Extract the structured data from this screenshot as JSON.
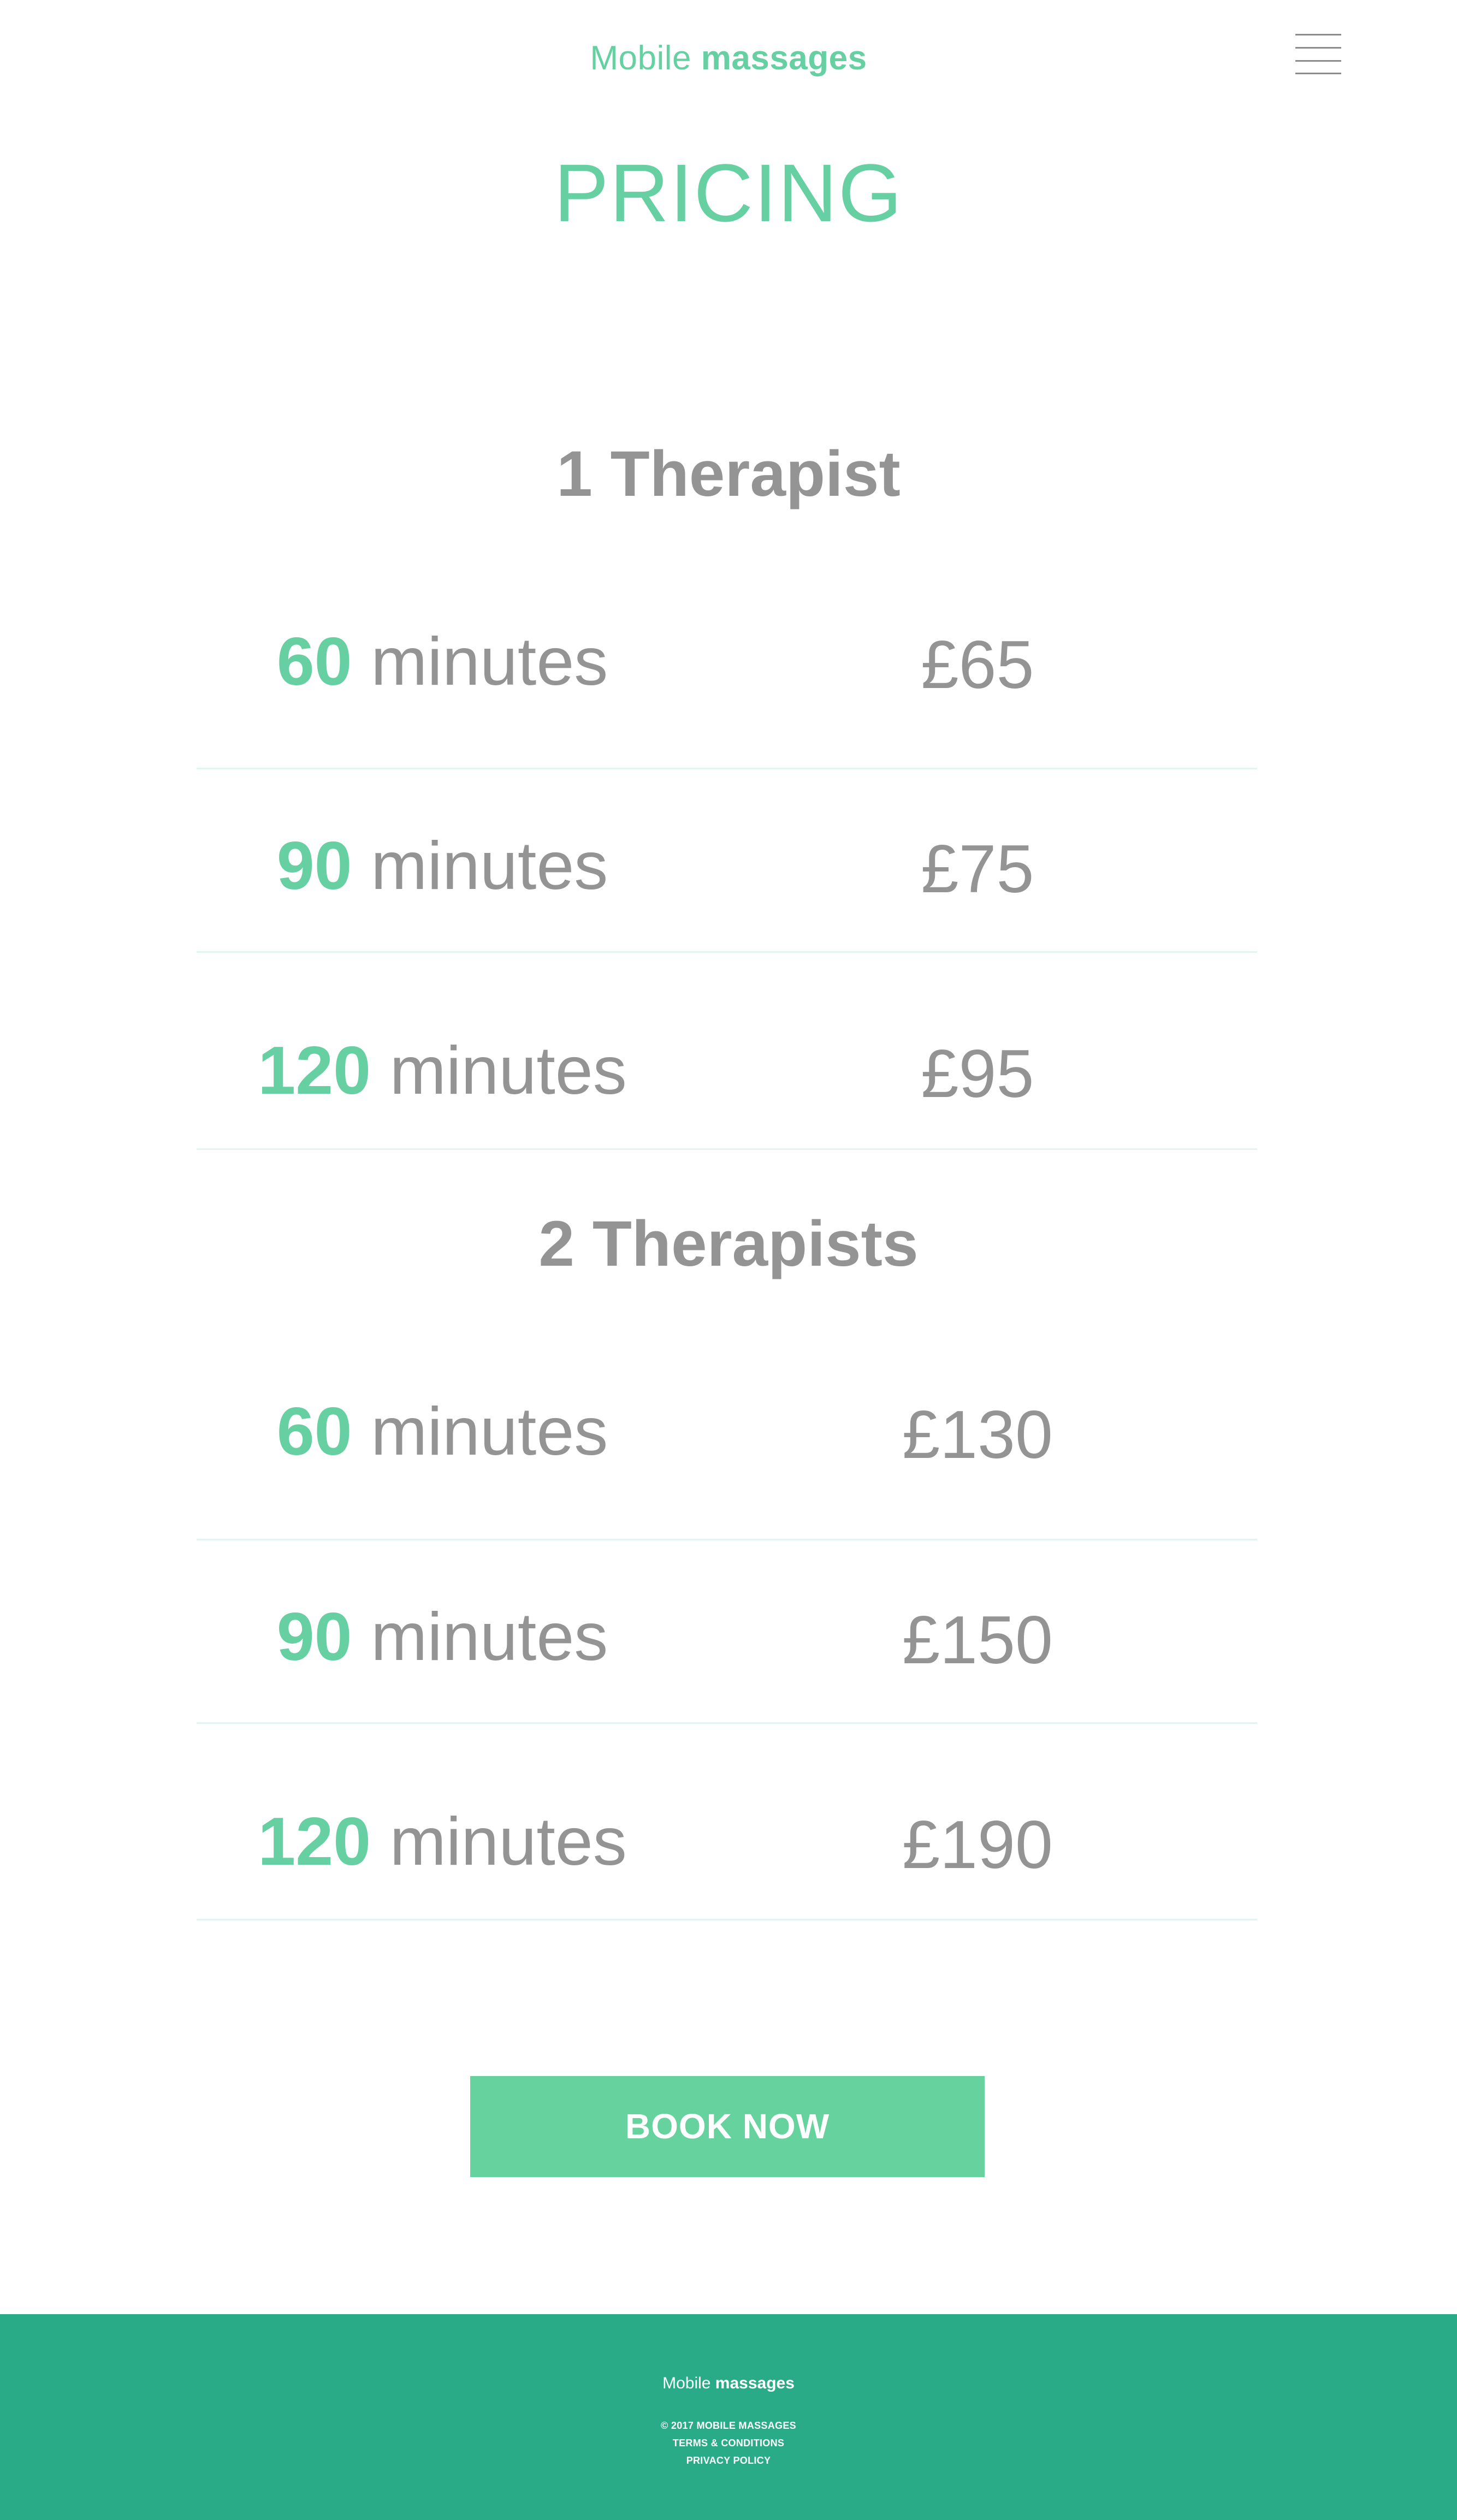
{
  "header": {
    "brand_light": "Mobile",
    "brand_bold": "massages",
    "menu_icon": "hamburger-menu-icon"
  },
  "page_title": "PRICING",
  "groups": [
    {
      "title": "1 Therapist",
      "rows": [
        {
          "duration": "60",
          "unit": "minutes",
          "price": "£65"
        },
        {
          "duration": "90",
          "unit": "minutes",
          "price": "£75"
        },
        {
          "duration": "120",
          "unit": "minutes",
          "price": "£95"
        }
      ]
    },
    {
      "title": "2 Therapists",
      "rows": [
        {
          "duration": "60",
          "unit": "minutes",
          "price": "£130"
        },
        {
          "duration": "90",
          "unit": "minutes",
          "price": "£150"
        },
        {
          "duration": "120",
          "unit": "minutes",
          "price": "£190"
        }
      ]
    }
  ],
  "cta": {
    "book_label": "BOOK NOW"
  },
  "footer": {
    "brand_light": "Mobile",
    "brand_bold": "massages",
    "copyright": "© 2017 MOBILE MASSAGES",
    "terms": "TERMS & CONDITIONS",
    "privacy": "PRIVACY POLICY"
  },
  "colors": {
    "accent": "#66d0a2",
    "text_gray": "#949494",
    "footer_bg": "#29ab88",
    "divider": "#e3f4f3"
  }
}
